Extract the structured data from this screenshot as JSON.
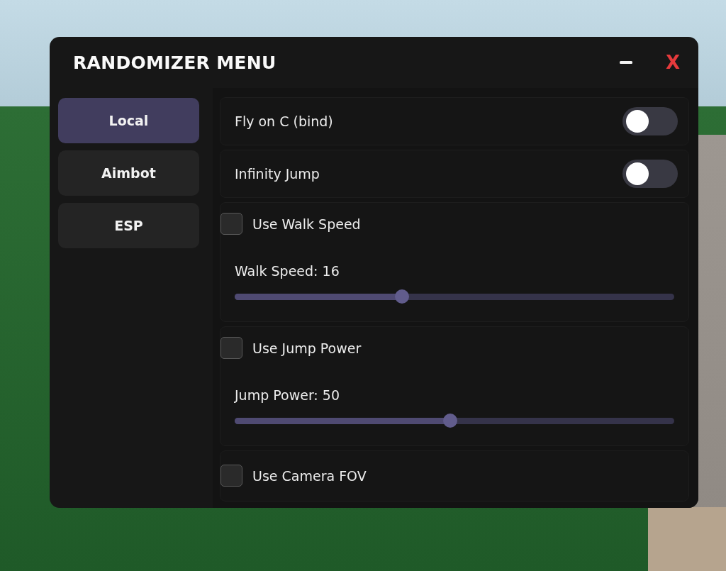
{
  "window": {
    "title": "RANDOMIZER MENU",
    "close": "X"
  },
  "tabs": [
    {
      "label": "Local",
      "selected": true
    },
    {
      "label": "Aimbot",
      "selected": false
    },
    {
      "label": "ESP",
      "selected": false
    }
  ],
  "settings": [
    {
      "kind": "toggle",
      "label": "Fly on C (bind)",
      "on": false
    },
    {
      "kind": "toggle",
      "label": "Infinity Jump",
      "on": false
    },
    {
      "kind": "slider_group",
      "checkbox": {
        "label": "Use Walk Speed",
        "checked": false
      },
      "slider": {
        "label": "Walk Speed: 16",
        "level": 0.38
      }
    },
    {
      "kind": "slider_group",
      "checkbox": {
        "label": "Use Jump Power",
        "checked": false
      },
      "slider": {
        "label": "Jump Power: 50",
        "level": 0.49
      }
    },
    {
      "kind": "checkbox",
      "label": "Use Camera FOV",
      "checked": false
    }
  ]
}
